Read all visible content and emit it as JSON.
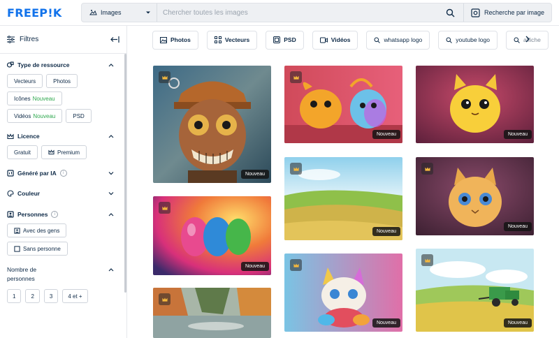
{
  "header": {
    "logo": "FREEP!K",
    "type_select": "Images",
    "search_placeholder": "Chercher toutes les images",
    "image_search_label": "Recherche par image"
  },
  "sidebar": {
    "title": "Filtres",
    "sections": {
      "resource": {
        "title": "Type de ressource",
        "chips": [
          {
            "label": "Vecteurs",
            "new": ""
          },
          {
            "label": "Photos",
            "new": ""
          },
          {
            "label": "Icônes",
            "new": "Nouveau"
          },
          {
            "label": "Vidéos",
            "new": "Nouveau"
          },
          {
            "label": "PSD",
            "new": ""
          }
        ]
      },
      "licence": {
        "title": "Licence",
        "chips": [
          "Gratuit",
          "Premium"
        ]
      },
      "ai": {
        "title": "Généré par IA"
      },
      "color": {
        "title": "Couleur"
      },
      "people": {
        "title": "Personnes",
        "chips": [
          "Avec des gens",
          "Sans personne"
        ]
      },
      "count": {
        "title_line1": "Nombre de",
        "title_line2": "personnes",
        "chips": [
          "1",
          "2",
          "3",
          "4 et +"
        ]
      }
    }
  },
  "tabs": [
    {
      "label": "Photos",
      "icon": "photo-icon",
      "bold": true
    },
    {
      "label": "Vecteurs",
      "icon": "vector-icon",
      "bold": true
    },
    {
      "label": "PSD",
      "icon": "psd-icon",
      "bold": true
    },
    {
      "label": "Vidéos",
      "icon": "video-icon",
      "bold": true
    },
    {
      "label": "whatsapp logo",
      "icon": "search-icon",
      "bold": false
    },
    {
      "label": "youtube logo",
      "icon": "search-icon",
      "bold": false
    },
    {
      "label": "affiche",
      "icon": "search-icon",
      "bold": false
    }
  ],
  "grid": {
    "badge": "Nouveau",
    "items": [
      {
        "name": "steampunk-monkey"
      },
      {
        "name": "rainbow-eggs"
      },
      {
        "name": "river-landscape"
      },
      {
        "name": "cartoon-animals"
      },
      {
        "name": "wheat-field"
      },
      {
        "name": "rainbow-kitten"
      },
      {
        "name": "yellow-cat-pokemon"
      },
      {
        "name": "golden-cat-ball"
      },
      {
        "name": "tractor-field"
      }
    ]
  },
  "colors": {
    "brand": "#1273eb",
    "new": "#2fa84f",
    "text": "#0e2a47"
  }
}
